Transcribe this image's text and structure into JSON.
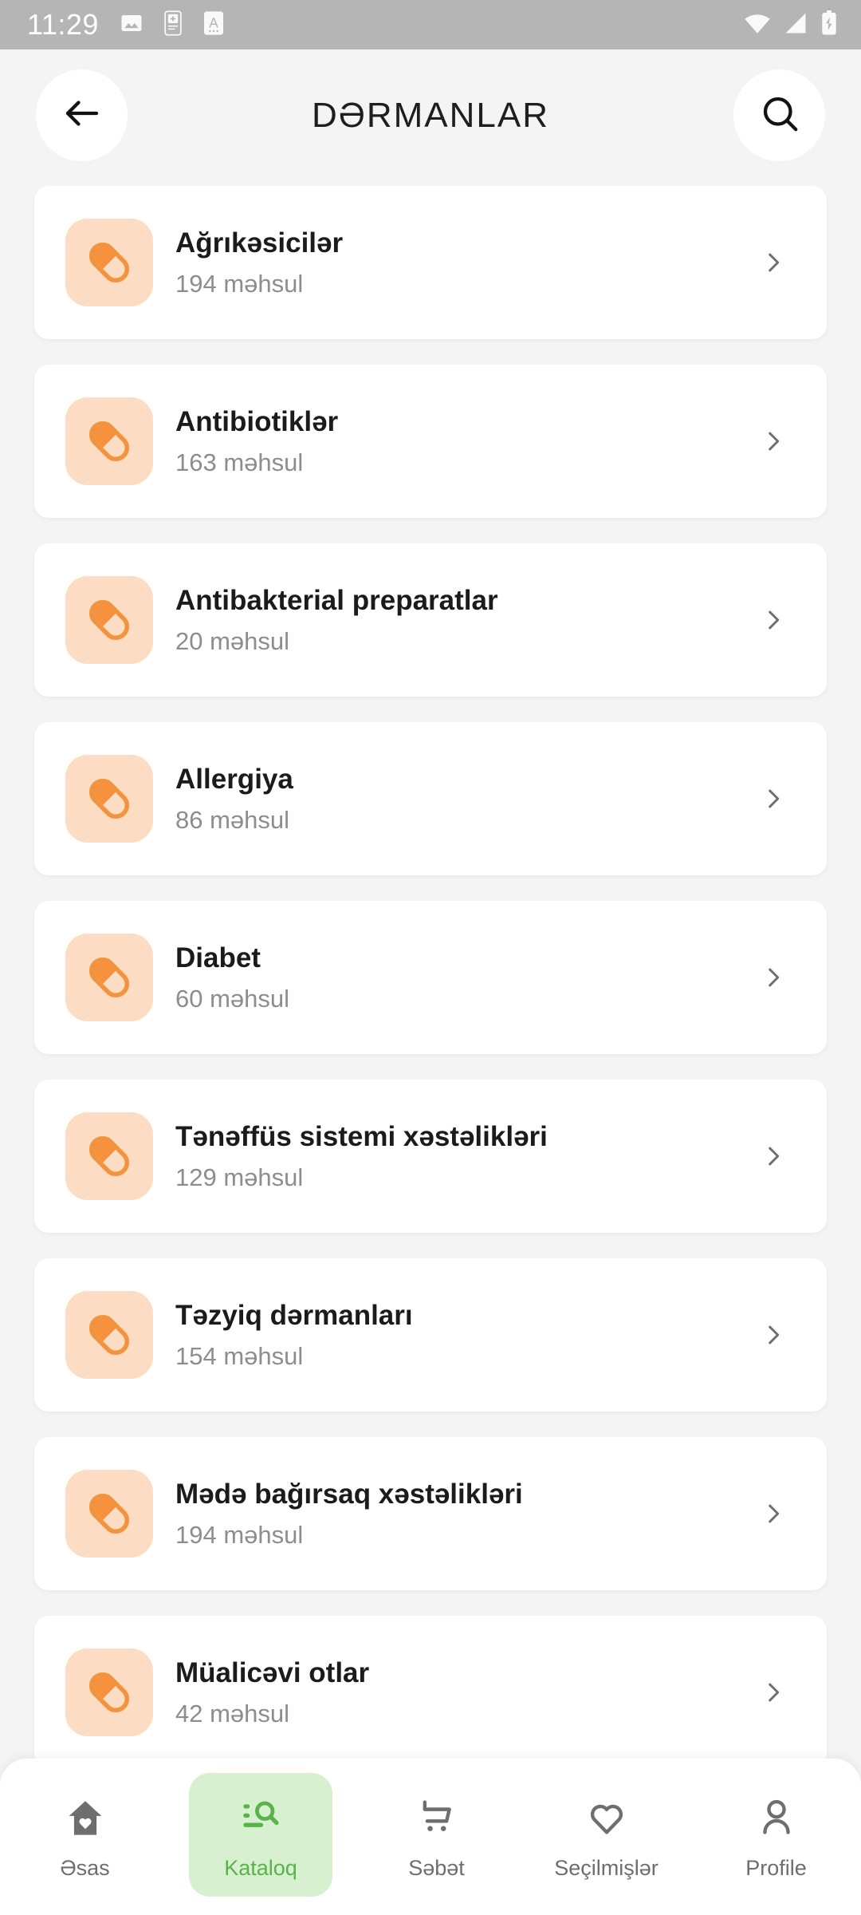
{
  "status_bar": {
    "time": "11:29",
    "notification_icons": [
      "image-icon",
      "pharmacy-app-icon",
      "letter-a-icon"
    ],
    "right_icons": [
      "wifi-icon",
      "cellular-signal-icon",
      "battery-charging-icon"
    ],
    "background_color": "#b5b5b5"
  },
  "header": {
    "title": "DƏRMANLAR",
    "back_icon": "arrow-left-icon",
    "search_icon": "search-icon"
  },
  "theme": {
    "page_background": "#f4f4f4",
    "card_background": "#ffffff",
    "icon_tile_background": "#fcdcc2",
    "pill_accent": "#f5923e",
    "title_color": "#1b1b1b",
    "subtitle_color": "#8d8d8d",
    "chevron_color": "#6e6e6e",
    "active_nav_background": "#d7f0cf",
    "active_nav_color": "#59b34a",
    "nav_inactive_color": "#6e6e6e"
  },
  "categories": [
    {
      "title": "Ağrıkəsicilər",
      "count": "194 məhsul",
      "icon": "pill-icon",
      "chevron": "chevron-right-icon"
    },
    {
      "title": "Antibiotiklər",
      "count": "163 məhsul",
      "icon": "pill-icon",
      "chevron": "chevron-right-icon"
    },
    {
      "title": "Antibakterial preparatlar",
      "count": "20 məhsul",
      "icon": "pill-icon",
      "chevron": "chevron-right-icon"
    },
    {
      "title": "Allergiya",
      "count": "86 məhsul",
      "icon": "pill-icon",
      "chevron": "chevron-right-icon"
    },
    {
      "title": "Diabet",
      "count": "60 məhsul",
      "icon": "pill-icon",
      "chevron": "chevron-right-icon"
    },
    {
      "title": "Tənəffüs sistemi xəstəlikləri",
      "count": "129 məhsul",
      "icon": "pill-icon",
      "chevron": "chevron-right-icon"
    },
    {
      "title": "Təzyiq dərmanları",
      "count": "154 məhsul",
      "icon": "pill-icon",
      "chevron": "chevron-right-icon"
    },
    {
      "title": "Mədə bağırsaq xəstəlikləri",
      "count": "194 məhsul",
      "icon": "pill-icon",
      "chevron": "chevron-right-icon"
    },
    {
      "title": "Müalicəvi otlar",
      "count": "42 məhsul",
      "icon": "pill-icon",
      "chevron": "chevron-right-icon"
    }
  ],
  "bottom_nav": {
    "items": [
      {
        "label": "Əsas",
        "icon": "home-heart-icon",
        "active": false
      },
      {
        "label": "Kataloq",
        "icon": "catalog-search-icon",
        "active": true
      },
      {
        "label": "Səbət",
        "icon": "shopping-cart-icon",
        "active": false
      },
      {
        "label": "Seçilmişlər",
        "icon": "heart-icon",
        "active": false
      },
      {
        "label": "Profile",
        "icon": "person-icon",
        "active": false
      }
    ]
  }
}
